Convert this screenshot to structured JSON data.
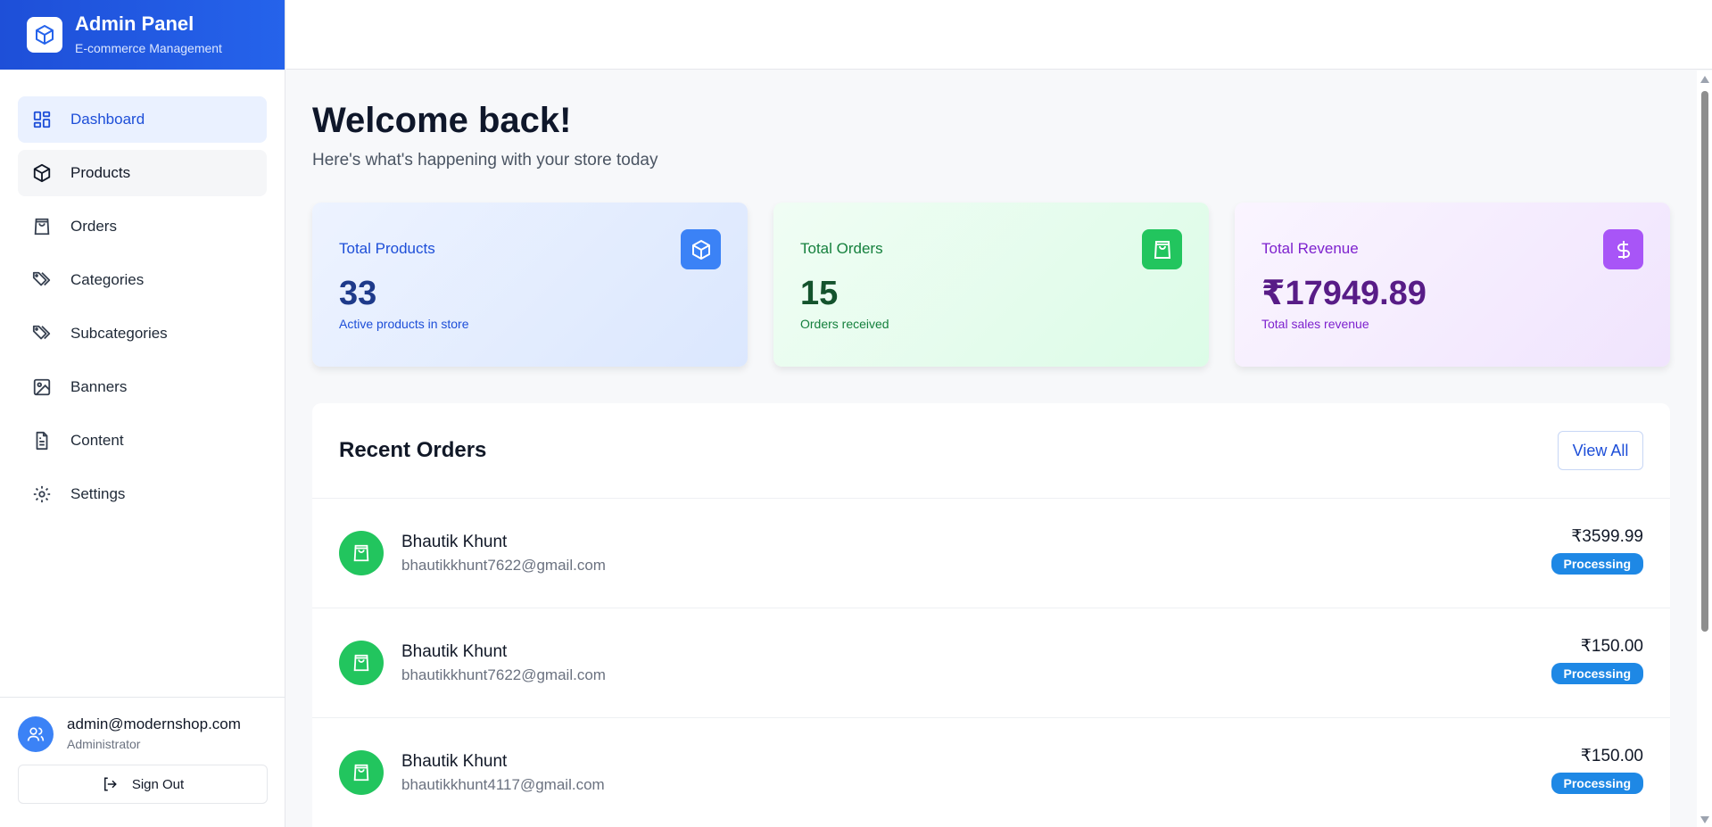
{
  "brand": {
    "title": "Admin Panel",
    "subtitle": "E-commerce Management",
    "logo_icon": "package-icon"
  },
  "nav": {
    "items": [
      {
        "label": "Dashboard",
        "icon": "dashboard-icon",
        "state": "active"
      },
      {
        "label": "Products",
        "icon": "package-icon",
        "state": "hover"
      },
      {
        "label": "Orders",
        "icon": "shopping-bag-icon",
        "state": "default"
      },
      {
        "label": "Categories",
        "icon": "tags-icon",
        "state": "default"
      },
      {
        "label": "Subcategories",
        "icon": "tags-icon",
        "state": "default"
      },
      {
        "label": "Banners",
        "icon": "image-icon",
        "state": "default"
      },
      {
        "label": "Content",
        "icon": "document-icon",
        "state": "default"
      },
      {
        "label": "Settings",
        "icon": "gear-icon",
        "state": "default"
      }
    ]
  },
  "user": {
    "email": "admin@modernshop.com",
    "role": "Administrator",
    "signout_label": "Sign Out"
  },
  "main": {
    "welcome": "Welcome back!",
    "subtitle": "Here's what's happening with your store today"
  },
  "stats": {
    "products": {
      "label": "Total Products",
      "value": "33",
      "desc": "Active products in store",
      "color": "#3b82f6"
    },
    "orders": {
      "label": "Total Orders",
      "value": "15",
      "desc": "Orders received",
      "color": "#22c55e"
    },
    "revenue": {
      "label": "Total Revenue",
      "value": "₹17949.89",
      "desc": "Total sales revenue",
      "color": "#a855f7"
    }
  },
  "recent_orders": {
    "title": "Recent Orders",
    "view_all": "View All",
    "rows": [
      {
        "name": "Bhautik Khunt",
        "email": "bhautikkhunt7622@gmail.com",
        "amount": "₹3599.99",
        "status": "Processing"
      },
      {
        "name": "Bhautik Khunt",
        "email": "bhautikkhunt7622@gmail.com",
        "amount": "₹150.00",
        "status": "Processing"
      },
      {
        "name": "Bhautik Khunt",
        "email": "bhautikkhunt4117@gmail.com",
        "amount": "₹150.00",
        "status": "Processing"
      }
    ]
  },
  "colors": {
    "accent": "#2563eb",
    "status_processing": "#1e88e5"
  }
}
